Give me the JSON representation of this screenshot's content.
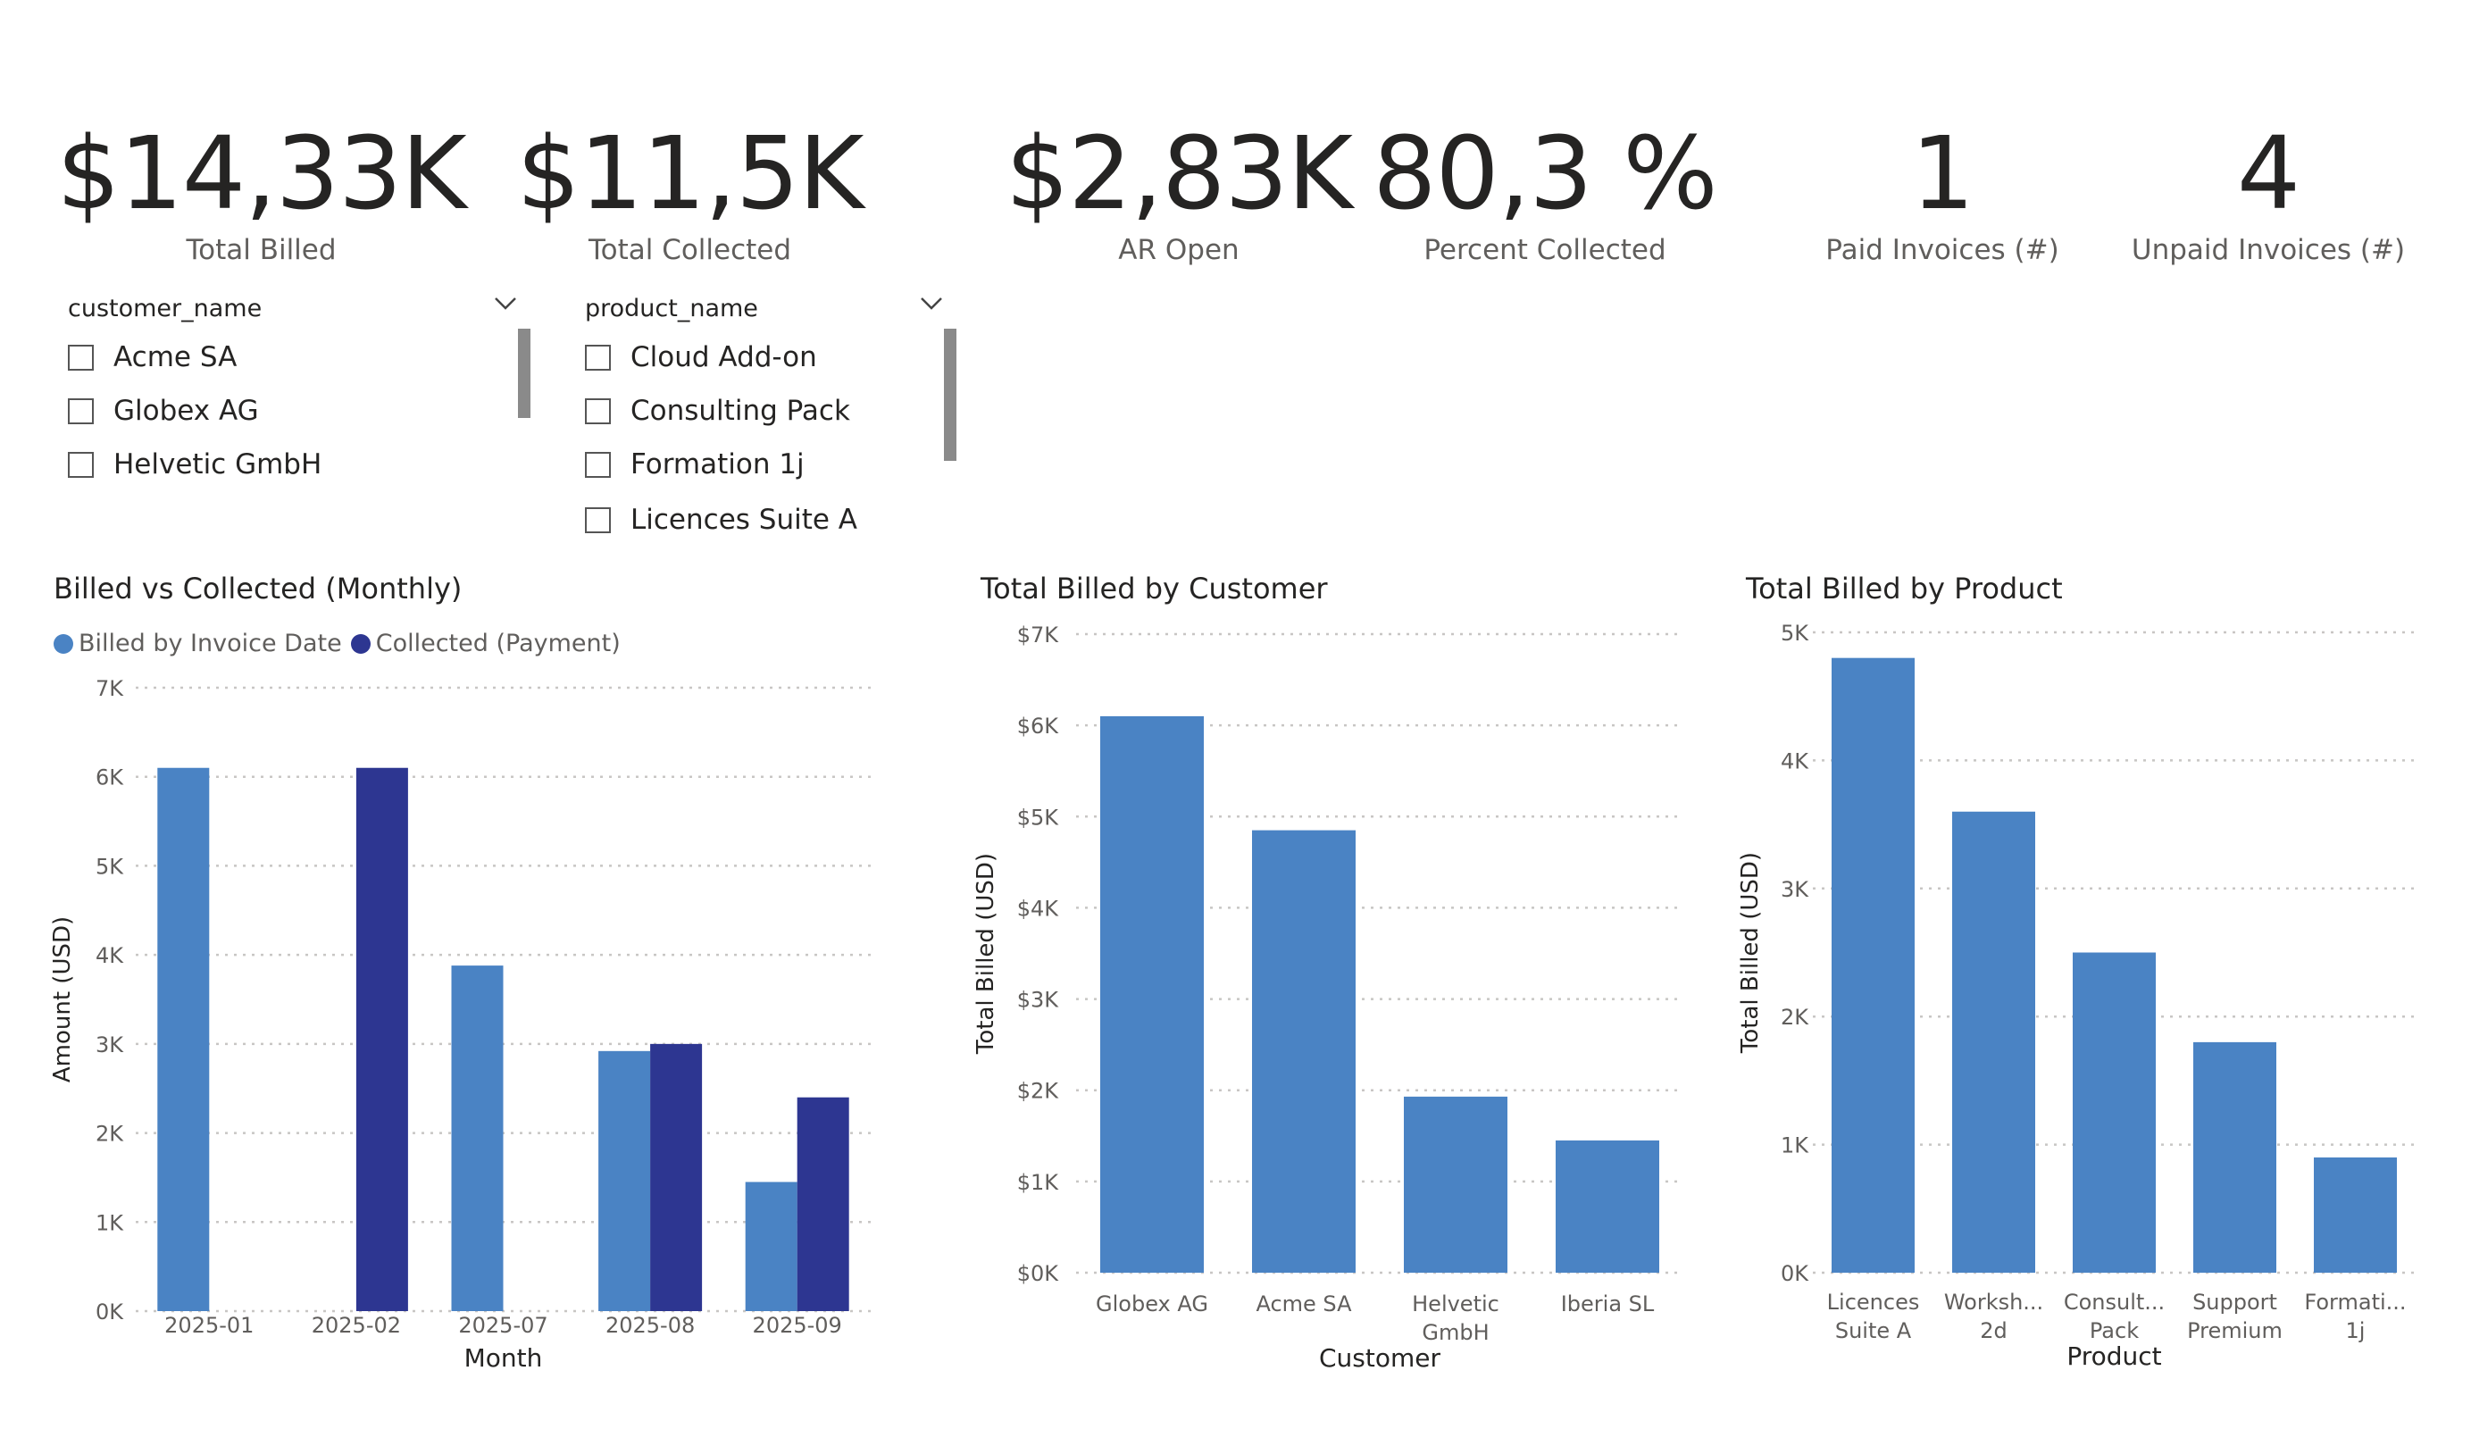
{
  "kpis": [
    {
      "value": "$14,33K",
      "label": "Total Billed"
    },
    {
      "value": "$11,5K",
      "label": "Total Collected"
    },
    {
      "value": "$2,83K",
      "label": "AR Open"
    },
    {
      "value": "80,3 %",
      "label": "Percent Collected"
    },
    {
      "value": "1",
      "label": "Paid Invoices (#)"
    },
    {
      "value": "4",
      "label": "Unpaid Invoices (#)"
    }
  ],
  "slicers": [
    {
      "title": "customer_name",
      "items": [
        "Acme SA",
        "Globex AG",
        "Helvetic GmbH"
      ]
    },
    {
      "title": "product_name",
      "items": [
        "Cloud Add-on",
        "Consulting Pack",
        "Formation 1j",
        "Licences Suite A"
      ]
    }
  ],
  "colors": {
    "billed": "#4a83c4",
    "collected": "#2d3691",
    "grid": "#c8c6c4",
    "text": "#605e5c"
  },
  "icons": {
    "slicer_dropdown": "chevron-down-icon"
  },
  "chart_data": [
    {
      "type": "bar",
      "title": "Billed vs Collected (Monthly)",
      "xlabel": "Month",
      "ylabel": "Amount (USD)",
      "ylim": [
        0,
        7000
      ],
      "yticks": [
        "0K",
        "1K",
        "2K",
        "3K",
        "4K",
        "5K",
        "6K",
        "7K"
      ],
      "categories": [
        "2025-01",
        "2025-02",
        "2025-07",
        "2025-08",
        "2025-09"
      ],
      "series": [
        {
          "name": "Billed by Invoice Date",
          "values": [
            6100,
            0,
            3880,
            2920,
            1450
          ]
        },
        {
          "name": "Collected (Payment)",
          "values": [
            0,
            6100,
            0,
            3000,
            2400
          ]
        }
      ],
      "legend": "top-left",
      "grid": true
    },
    {
      "type": "bar",
      "title": "Total Billed by Customer",
      "xlabel": "Customer",
      "ylabel": "Total Billed (USD)",
      "ylim": [
        0,
        7000
      ],
      "yticks": [
        "$0K",
        "$1K",
        "$2K",
        "$3K",
        "$4K",
        "$5K",
        "$6K",
        "$7K"
      ],
      "categories": [
        [
          "Globex AG"
        ],
        [
          "Acme SA"
        ],
        [
          "Helvetic",
          "GmbH"
        ],
        [
          "Iberia SL"
        ]
      ],
      "values": [
        6100,
        4850,
        1930,
        1450
      ],
      "grid": true
    },
    {
      "type": "bar",
      "title": "Total Billed by Product",
      "xlabel": "Product",
      "ylabel": "Total Billed (USD)",
      "ylim": [
        0,
        5000
      ],
      "yticks": [
        "0K",
        "1K",
        "2K",
        "3K",
        "4K",
        "5K"
      ],
      "categories": [
        [
          "Licences",
          "Suite A"
        ],
        [
          "Worksh...",
          "2d"
        ],
        [
          "Consult...",
          "Pack"
        ],
        [
          "Support",
          "Premium"
        ],
        [
          "Formati...",
          "1j"
        ]
      ],
      "values": [
        4800,
        3600,
        2500,
        1800,
        900
      ],
      "grid": true
    }
  ]
}
